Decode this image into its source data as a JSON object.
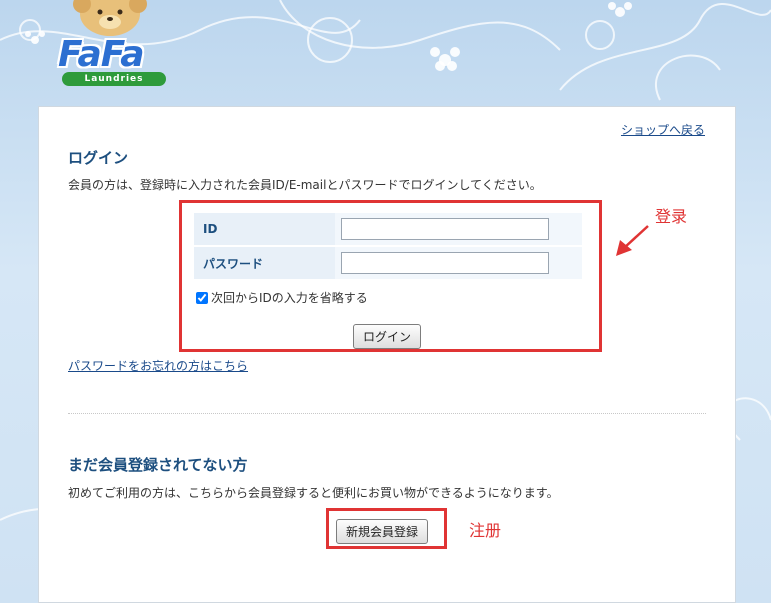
{
  "header": {
    "logo_text": "FaFa",
    "logo_sub": "Laundries",
    "back_link": "ショップへ戻る"
  },
  "login": {
    "title": "ログイン",
    "description": "会員の方は、登録時に入力された会員ID/E-mailとパスワードでログインしてください。",
    "id_label": "ID",
    "id_value": "",
    "password_label": "パスワード",
    "password_value": "",
    "remember_label": "次回からIDの入力を省略する",
    "remember_checked": true,
    "submit_label": "ログイン",
    "forgot_link": "パスワードをお忘れの方はこちら"
  },
  "register": {
    "title": "まだ会員登録されてない方",
    "description": "初めてご利用の方は、こちらから会員登録すると便利にお買い物ができるようになります。",
    "button_label": "新規会員登録"
  },
  "annotations": {
    "login_note": "登录",
    "register_note": "注册",
    "color": "#e03434"
  }
}
